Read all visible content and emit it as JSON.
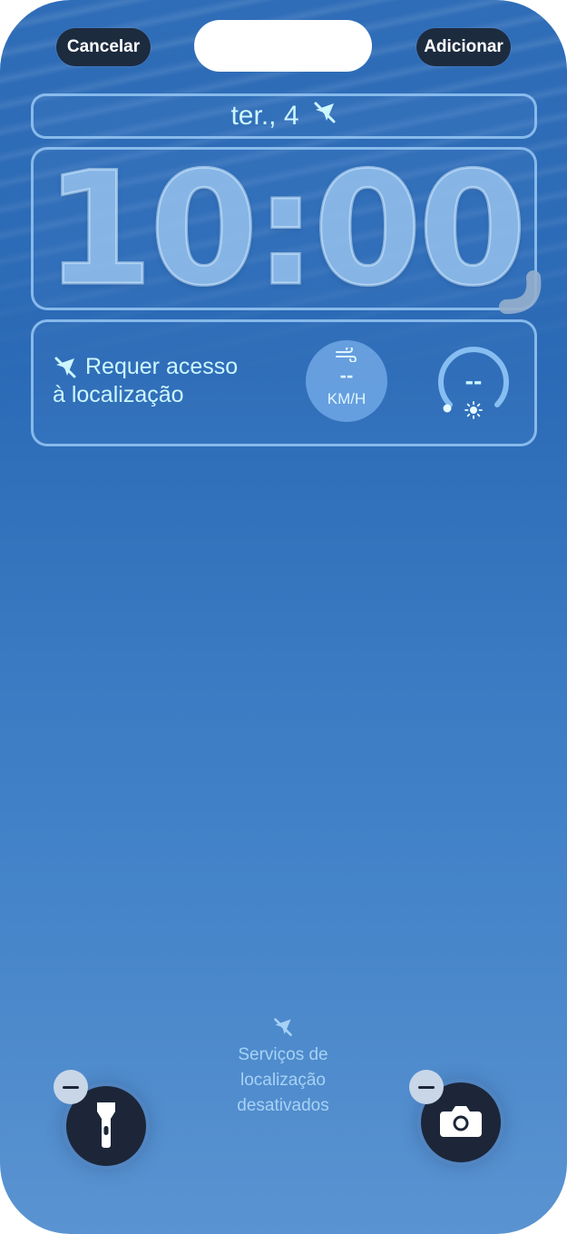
{
  "header": {
    "cancel_label": "Cancelar",
    "add_label": "Adicionar"
  },
  "date_widget": {
    "date_text": "ter., 4",
    "icon": "location-off-icon"
  },
  "clock": {
    "time": "10:00"
  },
  "widgets": {
    "location": {
      "icon": "location-off-icon",
      "line1": "Requer acesso",
      "line2": "à localização"
    },
    "wind": {
      "icon": "wind-icon",
      "value": "--",
      "unit": "KM/H"
    },
    "uv": {
      "icon": "sun-icon",
      "value": "--"
    }
  },
  "footer": {
    "icon": "location-off-icon",
    "message_line1": "Serviços de",
    "message_line2": "localização",
    "message_line3": "desativados"
  },
  "quick_actions": {
    "left_icon": "flashlight-icon",
    "right_icon": "camera-icon"
  },
  "colors": {
    "accent_text": "#cdf7ff",
    "button_dark": "#1d2b3f",
    "frame_border": "#96c8f5"
  }
}
